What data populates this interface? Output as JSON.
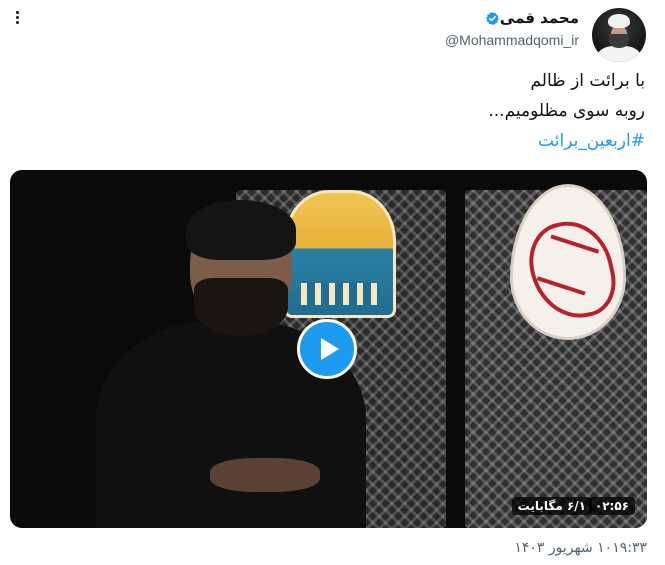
{
  "author": {
    "display_name": "محمد قمی",
    "handle": "@Mohammadqomi_ir",
    "verified_icon": "verified-badge-icon",
    "verified_color": "#1d9bf0"
  },
  "tweet": {
    "line1": "با برائت از ظالم",
    "line2": "روبه سوی مظلومیم...",
    "hashtag": "#اربعین_برائت",
    "hashtag_color": "#1d9bf0"
  },
  "video": {
    "duration": "۰۲:۵۶",
    "size": "۶/۱ مگابایت",
    "play_icon": "play-icon",
    "play_color": "#1d9bf0"
  },
  "meta": {
    "timestamp": "۱۰۱۹:۳۳ شهریور ۱۴۰۳"
  },
  "icons": {
    "more": "more-options-icon"
  }
}
